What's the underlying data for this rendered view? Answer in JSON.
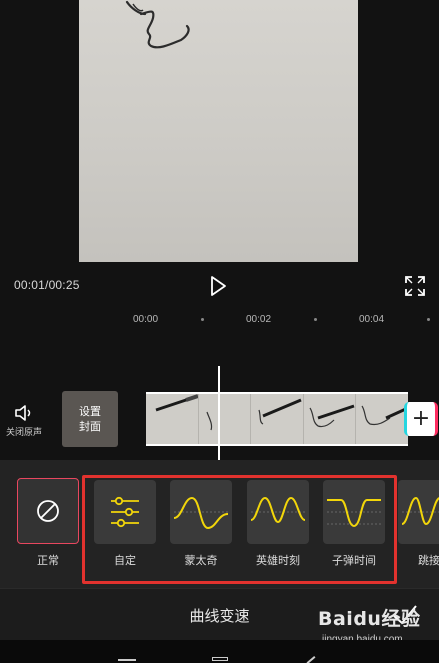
{
  "player": {
    "current_time": "00:01",
    "total_time": "00:25",
    "time_display": "00:01/00:25"
  },
  "ruler": {
    "marks": [
      "00:00",
      "00:02",
      "00:04"
    ]
  },
  "timeline": {
    "mute_label": "关闭原声",
    "cover_label": "设置封面",
    "add_clip": "+"
  },
  "speed_presets": [
    {
      "label": "正常",
      "icon": "prohibit-icon",
      "selected": true
    },
    {
      "label": "自定",
      "icon": "sliders-icon",
      "selected": false
    },
    {
      "label": "蒙太奇",
      "icon": "curve-montage-icon",
      "selected": false
    },
    {
      "label": "英雄时刻",
      "icon": "curve-hero-icon",
      "selected": false
    },
    {
      "label": "子弹时间",
      "icon": "curve-bullet-icon",
      "selected": false
    },
    {
      "label": "跳接",
      "icon": "curve-jump-icon",
      "selected": false
    }
  ],
  "panel": {
    "title": "曲线变速"
  },
  "watermark": {
    "logo": "Baidu经验",
    "url": "jingyan.baidu.com"
  },
  "colors": {
    "curve_yellow": "#f2d60a",
    "selected_border": "#e8475f",
    "annotation_red": "#e2322e"
  }
}
